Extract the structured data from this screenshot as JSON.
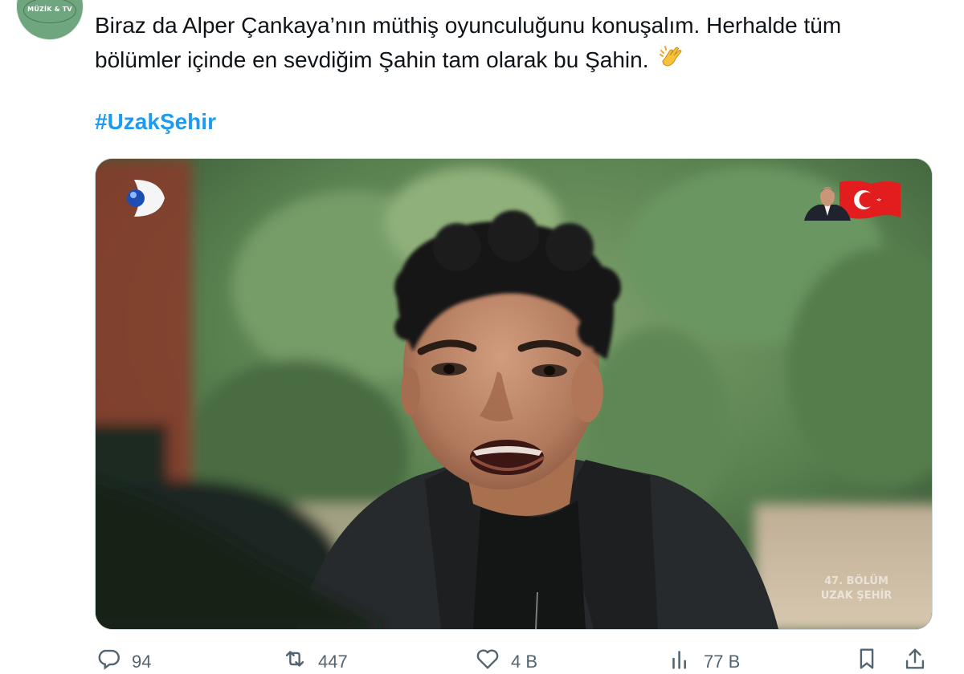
{
  "avatar": {
    "text": "MÜZİK & TV"
  },
  "tweet": {
    "line1": "Biraz da Alper Çankaya’nın müthiş oyunculuğunu konuşalım. Herhalde tüm",
    "line2": "bölümler içinde en sevdiğim Şahin tam olarak bu Şahin.",
    "emoji": "clapping-hands",
    "hashtag": "#UzakŞehir"
  },
  "media": {
    "watermark_line1": "47. BÖLÜM",
    "watermark_line2": "UZAK ŞEHİR",
    "channel_logo": "kanal-d-logo",
    "badge": "turkish-flag-badge"
  },
  "actions": {
    "reply": {
      "icon": "reply-icon",
      "count": "94"
    },
    "retweet": {
      "icon": "retweet-icon",
      "count": "447"
    },
    "like": {
      "icon": "heart-icon",
      "count": "4 B"
    },
    "views": {
      "icon": "views-icon",
      "count": "77 B"
    },
    "bookmark": {
      "icon": "bookmark-icon"
    },
    "share": {
      "icon": "share-icon"
    }
  },
  "colors": {
    "hashtag": "#1d9bf0",
    "text": "#0f1419",
    "muted": "#536471",
    "border": "#cfd9de"
  }
}
